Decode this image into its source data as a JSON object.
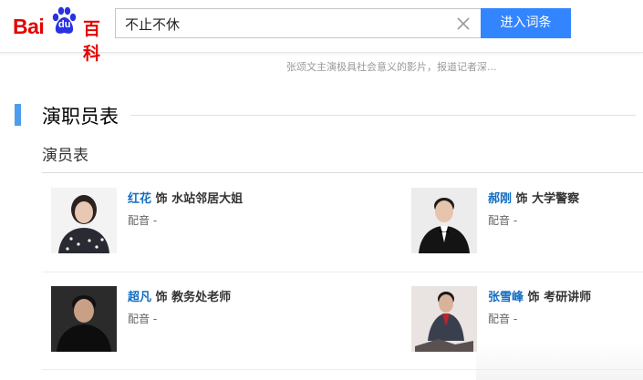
{
  "header": {
    "logo": {
      "bai": "Bai",
      "du": "du",
      "baike": "百科"
    },
    "search_value": "不止不休",
    "enter_button": "进入词条"
  },
  "intro": {
    "text": "张颂文主演极具社会意义的影片，报道记者深..."
  },
  "section": {
    "title": "演职员表",
    "subtitle": "演员表"
  },
  "colors": {
    "accent": "#4f9cee",
    "link": "#136ec2",
    "button": "#3385ff",
    "logo_red": "#e10602"
  },
  "cast": [
    {
      "actor": "红花",
      "role_prefix": "饰",
      "role": "水站邻居大姐",
      "dub_label": "配音",
      "dub_value": "-"
    },
    {
      "actor": "郝刚",
      "role_prefix": "饰",
      "role": "大学警察",
      "dub_label": "配音",
      "dub_value": "-"
    },
    {
      "actor": "超凡",
      "role_prefix": "饰",
      "role": "教务处老师",
      "dub_label": "配音",
      "dub_value": "-"
    },
    {
      "actor": "张雪峰",
      "role_prefix": "饰",
      "role": "考研讲师",
      "dub_label": "配音",
      "dub_value": "-"
    }
  ]
}
